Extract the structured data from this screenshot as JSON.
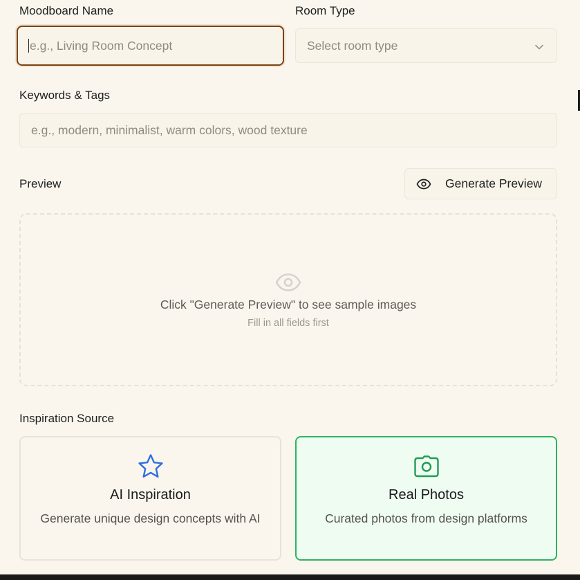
{
  "form": {
    "moodboard_name": {
      "label": "Moodboard Name",
      "placeholder": "e.g., Living Room Concept",
      "value": ""
    },
    "room_type": {
      "label": "Room Type",
      "placeholder": "Select room type"
    },
    "keywords": {
      "label": "Keywords & Tags",
      "placeholder": "e.g., modern, minimalist, warm colors, wood texture",
      "value": ""
    }
  },
  "preview": {
    "label": "Preview",
    "button_label": "Generate Preview",
    "empty_title": "Click \"Generate Preview\" to see sample images",
    "empty_subtitle": "Fill in all fields first",
    "icon": "eye-icon"
  },
  "inspiration": {
    "label": "Inspiration Source",
    "options": [
      {
        "title": "AI Inspiration",
        "description": "Generate unique design concepts with AI",
        "icon": "star-icon",
        "selected": false
      },
      {
        "title": "Real Photos",
        "description": "Curated photos from design platforms",
        "icon": "camera-icon",
        "selected": true
      }
    ]
  },
  "colors": {
    "background": "#faf6ee",
    "focus_border": "#7a4310",
    "selected_border": "#2eb35f",
    "selected_bg": "#effcf2",
    "ai_icon": "#2f6fe0",
    "photo_icon": "#1f9d55"
  }
}
